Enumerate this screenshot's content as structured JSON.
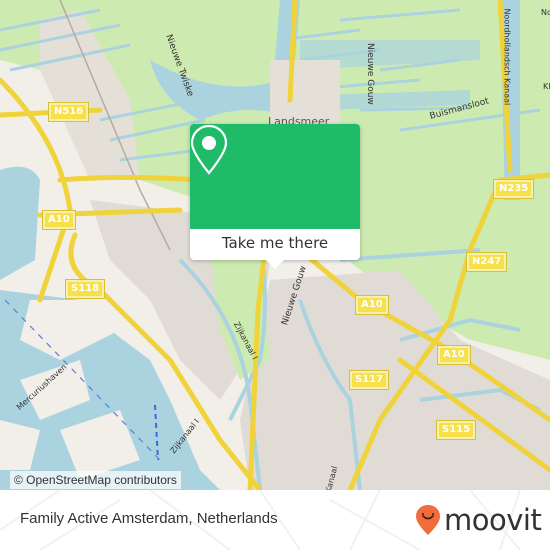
{
  "map": {
    "colors": {
      "land": "#f2efe9",
      "water": "#aad3df",
      "green": "#cdebb0",
      "urban": "#e0dcd5",
      "road": "#f8e04a",
      "accent": "#1fbb68",
      "brand": "#f06c3b"
    },
    "road_labels": [
      "N516",
      "A10",
      "S118",
      "N235",
      "N247",
      "A10",
      "A10",
      "S117",
      "S115"
    ],
    "place_labels": [
      "Nieuwe Twiske",
      "Landsmeer",
      "Nieuwe Gouw",
      "Buismansloot",
      "Noordhollandsch Kanaal",
      "Nieuwe Gouw",
      "Zijkanaal I",
      "Mercuriushaven",
      "Zijkanaal I",
      "Kanaal",
      "No",
      "Kl"
    ],
    "attribution": "© OpenStreetMap contributors"
  },
  "popup": {
    "icon": "map-pin-icon",
    "button_label": "Take me there"
  },
  "footer": {
    "title": "Family Active Amsterdam, Netherlands",
    "logo_text": "moovit",
    "logo_icon": "moovit-pin-icon"
  }
}
